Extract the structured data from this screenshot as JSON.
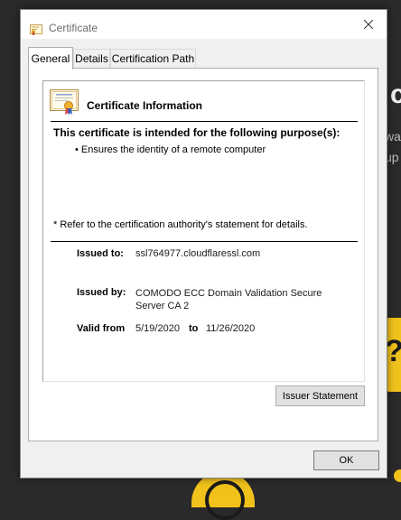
{
  "background": {
    "big_char": "c",
    "line1": "wa",
    "line2": "up",
    "mark": "?"
  },
  "window": {
    "title": "Certificate"
  },
  "tabs": [
    {
      "label": "General",
      "active": true
    },
    {
      "label": "Details",
      "active": false
    },
    {
      "label": "Certification Path",
      "active": false
    }
  ],
  "general": {
    "header": "Certificate Information",
    "purpose_header": "This certificate is intended for the following purpose(s):",
    "purpose_items": [
      "• Ensures the identity of a remote computer"
    ],
    "note": "* Refer to the certification authority's statement for details.",
    "issued_to_label": "Issued to:",
    "issued_to": "ssl764977.cloudflaressl.com",
    "issued_by_label": "Issued by:",
    "issued_by": "COMODO ECC Domain Validation Secure Server CA 2",
    "valid_from_label": "Valid from",
    "valid_from": "5/19/2020",
    "to_label": "to",
    "valid_to": "11/26/2020",
    "issuer_button": "Issuer Statement"
  },
  "footer": {
    "ok_button": "OK"
  },
  "colors": {
    "accent_yellow": "#f1c21b",
    "window_bg": "#f0f0f0"
  }
}
